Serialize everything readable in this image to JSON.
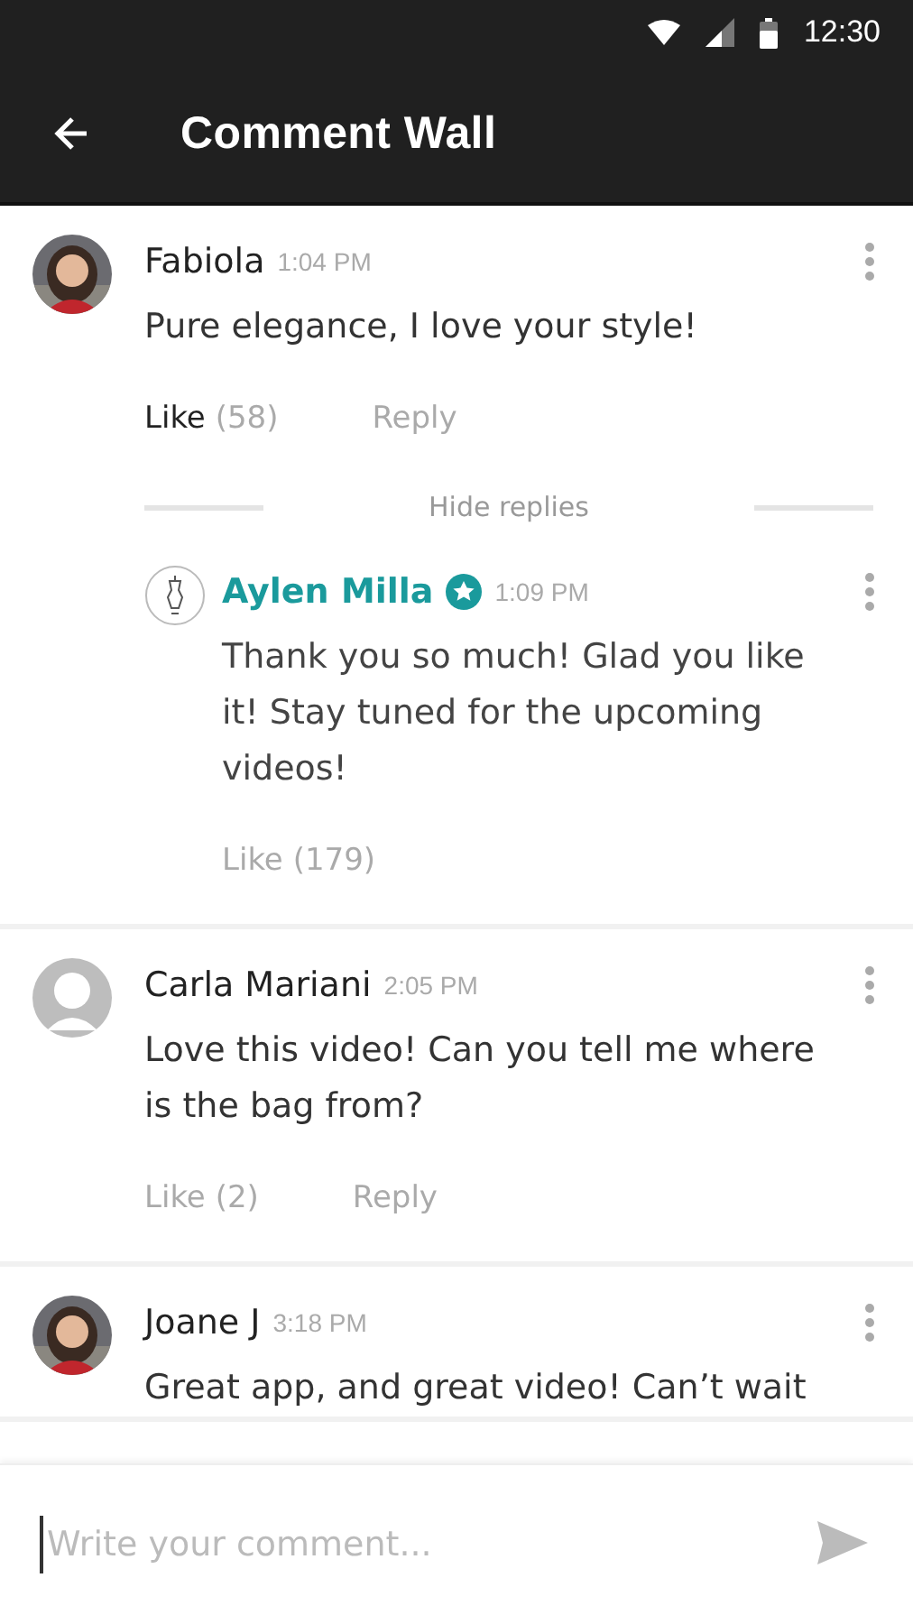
{
  "status_bar": {
    "time": "12:30"
  },
  "app_bar": {
    "title": "Comment Wall"
  },
  "comments": [
    {
      "author": "Fabiola",
      "verified": false,
      "time": "1:04 PM",
      "text": "Pure elegance, I love your style!",
      "like_label": "Like",
      "like_count": "(58)",
      "liked": true,
      "reply_label": "Reply",
      "hide_replies": "Hide replies",
      "replies": [
        {
          "author": "Aylen Milla",
          "avatar": {
            "kind": "logo"
          },
          "verified": true,
          "time": "1:09 PM",
          "text": "Thank you so much! Glad you like it! Stay tuned for the upcoming videos!",
          "like_label": "Like",
          "like_count": "(179)",
          "liked": false
        }
      ]
    },
    {
      "author": "Carla Mariani",
      "avatar": {
        "kind": "placeholder"
      },
      "verified": false,
      "time": "2:05 PM",
      "text": "Love this video! Can you tell me where is the bag from?",
      "like_label": "Like",
      "like_count": "(2)",
      "liked": false,
      "reply_label": "Reply"
    },
    {
      "author": "Joane J",
      "verified": false,
      "time": "3:18 PM",
      "text": "Great app, and great video! Can’t wait"
    }
  ],
  "composer": {
    "placeholder": "Write your comment..."
  }
}
